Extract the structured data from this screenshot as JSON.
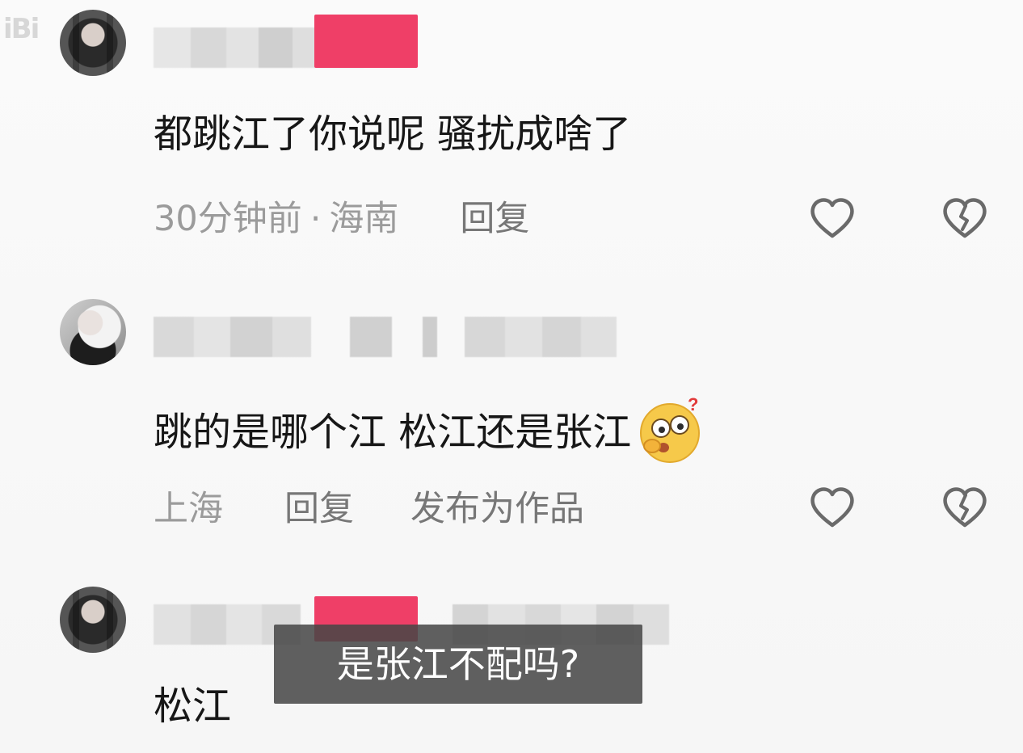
{
  "watermark": "iBi",
  "comments": [
    {
      "avatar": "dark-hair-avatar",
      "name_blurred": true,
      "has_badge": true,
      "text": "都跳江了你说呢 骚扰成啥了",
      "time": "30分钟前",
      "location": "海南",
      "reply_label": "回复",
      "like_icon": "heart-outline-icon",
      "dislike_icon": "broken-heart-icon"
    },
    {
      "avatar": "light-portrait-avatar",
      "name_blurred": true,
      "has_badge": false,
      "text": "跳的是哪个江 松江还是张江",
      "emoji": "confused-face-emoji",
      "location": "上海",
      "reply_label": "回复",
      "publish_label": "发布为作品",
      "like_icon": "heart-outline-icon",
      "dislike_icon": "broken-heart-icon"
    },
    {
      "avatar": "dark-hair-avatar",
      "name_blurred": true,
      "has_badge": true,
      "text": "松江"
    }
  ],
  "subtitle": "是张江不配吗?",
  "colors": {
    "badge": "#ef3f67",
    "meta_text": "#9b9b9b",
    "action_text": "#777777",
    "main_text": "#171717"
  }
}
